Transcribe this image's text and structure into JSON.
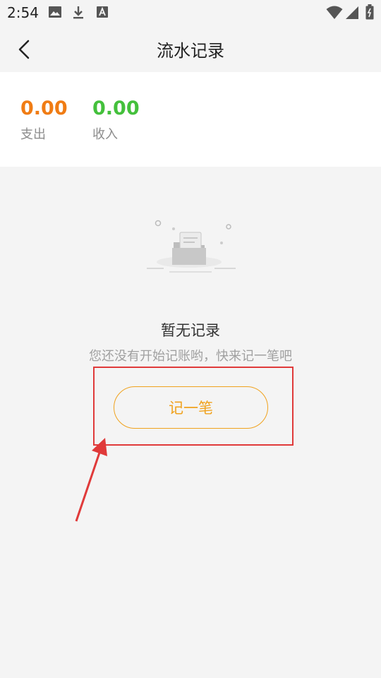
{
  "status_bar": {
    "time": "2:54",
    "left_icons": [
      "image-icon",
      "download-icon",
      "a-icon"
    ],
    "right_icons": [
      "wifi-icon",
      "signal-icon",
      "battery-icon"
    ]
  },
  "header": {
    "title": "流水记录",
    "back_icon": "chevron-left-icon"
  },
  "summary": {
    "expense": {
      "value": "0.00",
      "label": "支出",
      "color": "#f07c14"
    },
    "income": {
      "value": "0.00",
      "label": "收入",
      "color": "#44c03c"
    }
  },
  "empty_state": {
    "illustration": "empty-folder-icon",
    "title": "暂无记录",
    "subtitle": "您还没有开始记账哟，快来记一笔吧",
    "button_label": "记一笔"
  },
  "colors": {
    "accent": "#f0a21e",
    "annotation": "#e03a3a",
    "background": "#f4f4f4"
  }
}
